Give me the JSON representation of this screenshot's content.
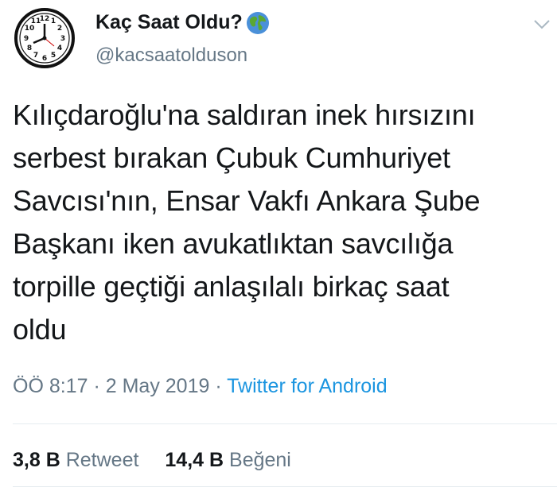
{
  "author": {
    "display_name": "Kaç Saat Oldu?",
    "handle": "@kacsaatolduson",
    "avatar_icon": "clock-icon",
    "badge_icon": "globe-icon"
  },
  "tweet": {
    "text": "Kılıçdaroğlu'na saldıran inek hırsızını\nserbest bırakan Çubuk Cumhuriyet\nSavcısı'nın, Ensar Vakfı Ankara Şube\nBaşkanı iken avukatlıktan savcılığa\ntorpille geçtiği anlaşılalı birkaç saat\noldu",
    "time": "ÖÖ 8:17",
    "separator": "·",
    "date": "2 May 2019",
    "source": "Twitter for Android"
  },
  "stats": {
    "retweets_count": "3,8 B",
    "retweets_label": "Retweet",
    "likes_count": "14,4 B",
    "likes_label": "Beğeni"
  },
  "colors": {
    "text": "#14171a",
    "secondary": "#657786",
    "link": "#1b95e0",
    "divider": "#e6ecf0"
  }
}
